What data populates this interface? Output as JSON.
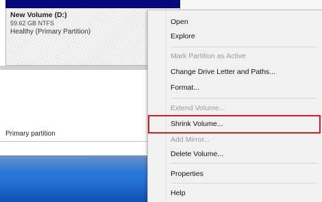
{
  "partition": {
    "name": "New Volume  (D:)",
    "size": "59.62 GB NTFS",
    "status": "Healthy (Primary Partition)"
  },
  "legend": {
    "label": "Primary partition"
  },
  "context_menu": {
    "items": [
      {
        "label": "Open",
        "enabled": true
      },
      {
        "label": "Explore",
        "enabled": true
      },
      {
        "label": "Mark Partition as Active",
        "enabled": false
      },
      {
        "label": "Change Drive Letter and Paths...",
        "enabled": true
      },
      {
        "label": "Format...",
        "enabled": true
      },
      {
        "label": "Extend Volume...",
        "enabled": false
      },
      {
        "label": "Shrink Volume...",
        "enabled": true,
        "highlighted": true
      },
      {
        "label": "Add Mirror...",
        "enabled": false
      },
      {
        "label": "Delete Volume...",
        "enabled": true
      },
      {
        "label": "Properties",
        "enabled": true
      },
      {
        "label": "Help",
        "enabled": true
      }
    ]
  },
  "colors": {
    "partition_header": "#060a7c",
    "highlight_border": "#d81921",
    "taskbar": "#1f6fd2"
  }
}
